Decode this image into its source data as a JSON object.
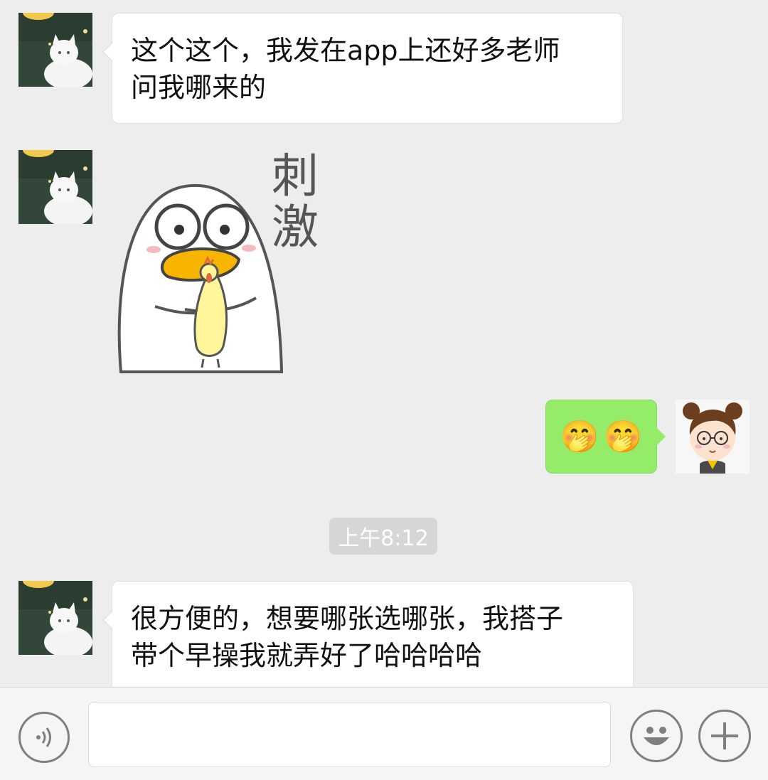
{
  "messages": [
    {
      "text_line1": "这个这个，我发在app上还好多老师",
      "text_line2": "问我哪来的"
    },
    {
      "sticker_text": [
        "刺",
        "激"
      ]
    },
    {
      "emoji": [
        "🤭",
        "🤭"
      ]
    },
    {
      "text_line1": "很方便的，想要哪张选哪张，我搭子",
      "text_line2": "带个早操我就弄好了哈哈哈哈"
    }
  ],
  "timestamp": "上午8:12",
  "input": {
    "placeholder": "",
    "value": ""
  },
  "colors": {
    "background": "#ededed",
    "bubble_self": "#95ec69",
    "bubble_other": "#ffffff"
  },
  "icons": [
    "voice-icon",
    "emoji-icon",
    "plus-icon"
  ]
}
